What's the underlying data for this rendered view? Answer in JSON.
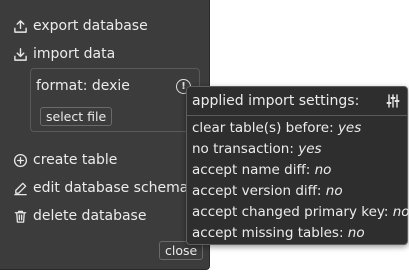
{
  "menu": {
    "export_label": "export database",
    "import_label": "import data",
    "format_label": "format: dexie",
    "info_glyph": "!",
    "select_file_label": "select file",
    "create_table_label": "create table",
    "edit_schema_label": "edit database schema",
    "delete_label": "delete database",
    "close_label": "close"
  },
  "popup": {
    "title": "applied import settings:",
    "rows": [
      {
        "label": "clear table(s) before: ",
        "value": "yes"
      },
      {
        "label": "no transaction: ",
        "value": "yes"
      },
      {
        "label": "accept name diff: ",
        "value": "no"
      },
      {
        "label": "accept version diff: ",
        "value": "no"
      },
      {
        "label": "accept changed primary key: ",
        "value": "no"
      },
      {
        "label": "accept missing tables: ",
        "value": "no"
      }
    ]
  },
  "icons": {
    "export": "upload-icon",
    "import": "download-icon",
    "info": "info-icon",
    "create": "plus-circle-icon",
    "edit": "pencil-icon",
    "delete": "trash-icon",
    "settings": "sliders-icon"
  },
  "colors": {
    "menu_bg": "#3c3c3c",
    "popup_bg": "#2e2e2e",
    "text": "#ececec",
    "border": "#5a5a5a"
  }
}
